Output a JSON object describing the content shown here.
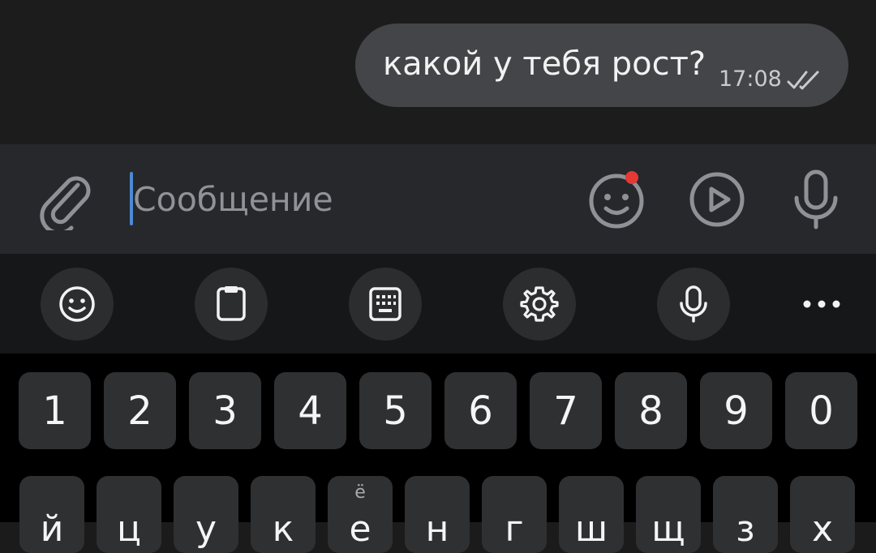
{
  "chat": {
    "message": {
      "text": "какой у тебя рост?",
      "time": "17:08",
      "status_icon": "double-check-icon"
    }
  },
  "composer": {
    "placeholder": "Сообщение",
    "attach_icon": "paperclip-icon",
    "emoji_icon": "emoji-icon",
    "emoji_badge_color": "#e53935",
    "video_icon": "play-circle-icon",
    "mic_icon": "microphone-icon"
  },
  "keyboard_toolbar": {
    "buttons": [
      "emoji-icon",
      "clipboard-icon",
      "keyboard-layout-icon",
      "gear-icon",
      "microphone-icon",
      "more-icon"
    ]
  },
  "keyboard": {
    "number_row": [
      "1",
      "2",
      "3",
      "4",
      "5",
      "6",
      "7",
      "8",
      "9",
      "0"
    ],
    "letter_row": [
      "й",
      "ц",
      "у",
      "к",
      "е",
      "н",
      "г",
      "ш",
      "щ",
      "з",
      "х"
    ],
    "letter_hint_e": "ё"
  },
  "colors": {
    "accent_cursor": "#4c8ad5",
    "bubble": "#434548"
  }
}
